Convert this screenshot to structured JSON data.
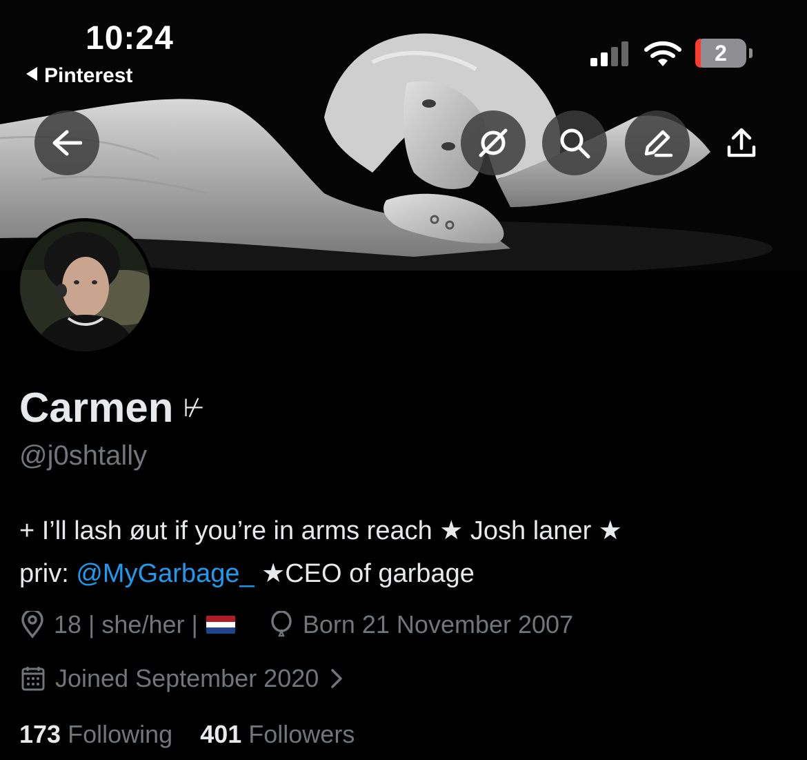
{
  "status_bar": {
    "time": "10:24",
    "back_app": "Pinterest",
    "battery": "2"
  },
  "header_buttons": {
    "back": "arrow-left-icon",
    "grok": "slashed-circle-icon",
    "search": "search-icon",
    "edit": "pencil-icon",
    "share": "share-upload-icon"
  },
  "profile": {
    "display_name": "Carmen",
    "name_glyph": "⊬",
    "handle": "@j0shtally",
    "bio_part1": "+ I’ll lash øut if you’re in arms reach ★ Josh laner ★",
    "bio_part2_prefix": "priv: ",
    "bio_link": "@MyGarbage_",
    "bio_part2_suffix": " ★CEO of garbage",
    "location": "18 | she/her |",
    "birthday": "Born 21 November 2007",
    "joined": "Joined September 2020",
    "following_count": "173",
    "following_label": "Following",
    "followers_count": "401",
    "followers_label": "Followers"
  },
  "colors": {
    "background": "#000000",
    "link": "#1d9bf0",
    "muted": "#71767b",
    "text": "#e7e9ea"
  }
}
